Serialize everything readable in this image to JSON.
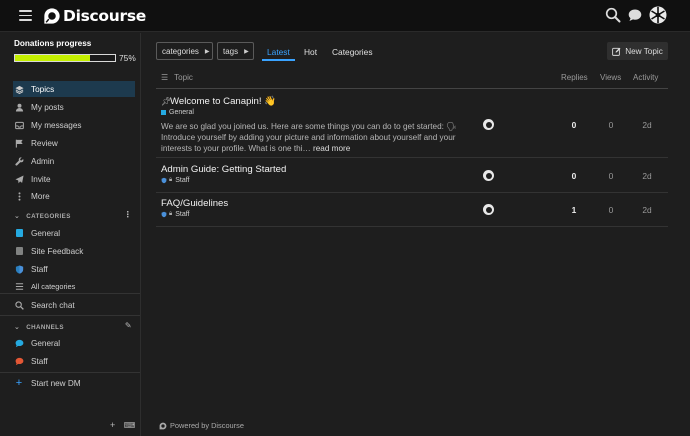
{
  "header": {
    "logo_text": "Discourse",
    "icons": [
      "hamburger-icon",
      "search-icon",
      "chat-icon",
      "user-avatar"
    ]
  },
  "sidebar": {
    "progress": {
      "title": "Donations progress",
      "percent_label": "75%",
      "fraction": 0.75,
      "fill_color": "#c4ef00"
    },
    "items": [
      {
        "label": "Topics",
        "icon": "layers-icon",
        "active": true
      },
      {
        "label": "My posts",
        "icon": "user-icon"
      },
      {
        "label": "My messages",
        "icon": "inbox-icon"
      },
      {
        "label": "Review",
        "icon": "flag-icon"
      },
      {
        "label": "Admin",
        "icon": "wrench-icon"
      },
      {
        "label": "Invite",
        "icon": "paper-plane-icon"
      },
      {
        "label": "More",
        "icon": "ellipsis-icon"
      }
    ],
    "categories_header": "CATEGORIES",
    "categories": [
      {
        "label": "General",
        "color": "#25aae1"
      },
      {
        "label": "Site Feedback",
        "color": "#808281"
      },
      {
        "label": "Staff",
        "color": "#e45735"
      }
    ],
    "all_categories": "All categories",
    "search_chat": "Search chat",
    "channels_header": "CHANNELS",
    "channels": [
      {
        "label": "General",
        "color": "#25aae1"
      },
      {
        "label": "Staff",
        "color": "#e45735"
      }
    ],
    "start_dm": "Start new DM"
  },
  "nav": {
    "categories_dropdown": "categories",
    "tags_dropdown": "tags",
    "tabs": [
      "Latest",
      "Hot",
      "Categories"
    ],
    "new_topic": "New Topic"
  },
  "table": {
    "headers": {
      "topic": "Topic",
      "replies": "Replies",
      "views": "Views",
      "activity": "Activity"
    },
    "rows": [
      {
        "title": "Welcome to Canapin! 👋",
        "pinned": true,
        "category": "General",
        "category_color": "#25aae1",
        "excerpt": "We are so glad you joined us. Here are some things you can do to get started: 🗣 Introduce yourself by adding your picture and information about yourself and your interests to your profile. What is one thi…",
        "read_more": "read more",
        "replies": "0",
        "views": "0",
        "activity": "2d"
      },
      {
        "title": "Admin Guide: Getting Started",
        "category": "Staff",
        "category_color": "#e45735",
        "replies": "0",
        "views": "0",
        "activity": "2d"
      },
      {
        "title": "FAQ/Guidelines",
        "category": "Staff",
        "category_color": "#e45735",
        "replies": "1",
        "views": "0",
        "activity": "2d"
      }
    ]
  },
  "footer": {
    "powered_by": "Powered by Discourse"
  },
  "colors": {
    "accent": "#3aa3ff",
    "background": "#1e1e1e",
    "header_bg": "#101010"
  }
}
